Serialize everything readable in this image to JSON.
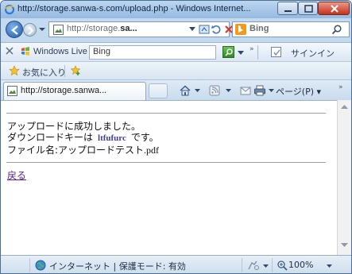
{
  "window": {
    "title": "http://storage.sanwa-s.com/upload.php - Windows Internet..."
  },
  "address_bar": {
    "url_prefix": "http://storage.",
    "url_bold": "sa...",
    "search_provider": "Bing"
  },
  "live_toolbar": {
    "brand": "Windows Live",
    "search_value": "Bing",
    "signin_label": "サインイン"
  },
  "favorites_bar": {
    "label": "お気に入り"
  },
  "tab": {
    "label": "http://storage.sanwa..."
  },
  "command_bar": {
    "page_menu": "ページ(P)"
  },
  "content": {
    "line1": "アップロードに成功しました。",
    "line2_prefix": "ダウンロードキーは",
    "download_key": "ltfufurc",
    "line2_suffix": "です。",
    "line3_prefix": "ファイル名:",
    "file_name": "アップロードテスト.pdf",
    "back_link": "戻る"
  },
  "status_bar": {
    "zone": "インターネット | 保護モード: 有効",
    "zoom": "100%"
  },
  "colors": {
    "link": "#5a1f94",
    "download_key": "#4040a0",
    "close_button": "#c5301b"
  }
}
